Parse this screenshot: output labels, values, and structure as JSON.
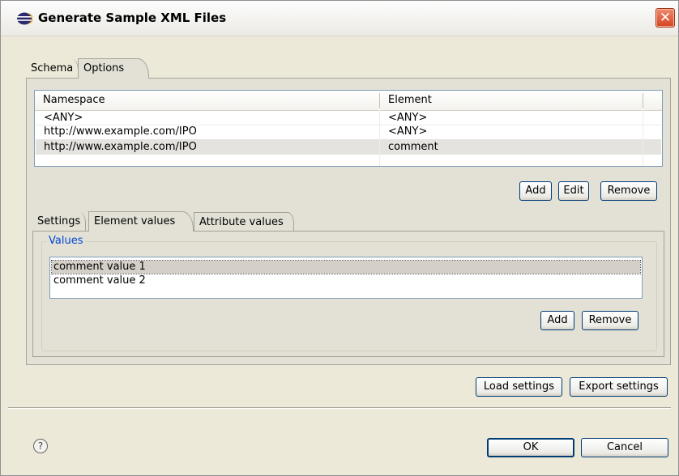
{
  "window": {
    "title": "Generate Sample XML Files",
    "close_glyph": "✕"
  },
  "top_tabs": [
    {
      "label": "Schema",
      "active": false
    },
    {
      "label": "Options",
      "active": true
    }
  ],
  "element_table": {
    "columns": [
      "Namespace",
      "Element"
    ],
    "rows": [
      {
        "namespace": "<ANY>",
        "element": "<ANY>",
        "selected": false
      },
      {
        "namespace": "http://www.example.com/IPO",
        "element": "<ANY>",
        "selected": false
      },
      {
        "namespace": "http://www.example.com/IPO",
        "element": "comment",
        "selected": true
      }
    ],
    "buttons": {
      "add": "Add",
      "edit": "Edit",
      "remove": "Remove"
    }
  },
  "inner_tabs": [
    {
      "label": "Settings",
      "active": false
    },
    {
      "label": "Element values",
      "active": true
    },
    {
      "label": "Attribute values",
      "active": false
    }
  ],
  "values_group": {
    "label": "Values",
    "items": [
      {
        "label": "comment value 1",
        "selected": true
      },
      {
        "label": "comment value 2",
        "selected": false
      }
    ],
    "buttons": {
      "add": "Add",
      "remove": "Remove"
    }
  },
  "settings_buttons": {
    "load": "Load settings",
    "export": "Export settings"
  },
  "footer": {
    "help_glyph": "?",
    "ok": "OK",
    "cancel": "Cancel"
  },
  "icons": {
    "app": "eclipse-icon",
    "close": "close-icon",
    "help": "help-icon"
  }
}
